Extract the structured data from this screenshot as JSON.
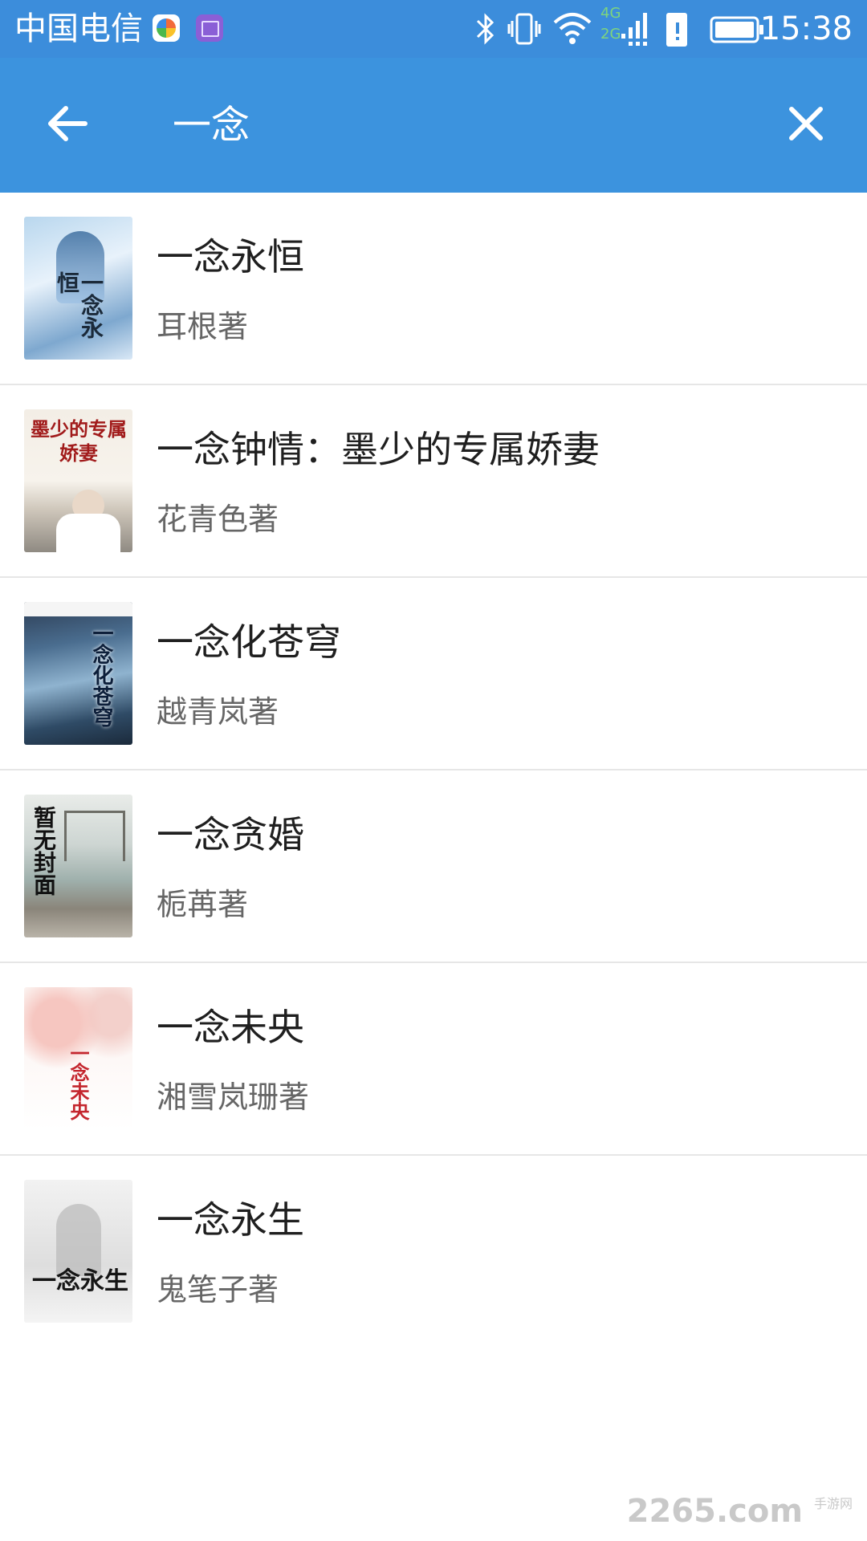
{
  "status_bar": {
    "carrier": "中国电信",
    "network_top": "4G",
    "network_bottom": "2G",
    "time": "15:38"
  },
  "search": {
    "query": "一念"
  },
  "results": [
    {
      "title": "一念永恒",
      "author": "耳根著",
      "cover_text": "一念永恒"
    },
    {
      "title": "一念钟情：墨少的专属娇妻",
      "author": "花青色著",
      "cover_text": "墨少的专属娇妻"
    },
    {
      "title": "一念化苍穹",
      "author": "越青岚著",
      "cover_text": "一念化苍穹"
    },
    {
      "title": "一念贪婚",
      "author": "栀苒著",
      "cover_text": "暂无封面"
    },
    {
      "title": "一念未央",
      "author": "湘雪岚珊著",
      "cover_text": "一念未央"
    },
    {
      "title": "一念永生",
      "author": "鬼笔子著",
      "cover_text": "一念永生"
    }
  ],
  "watermark": {
    "brand": "2265",
    "domain": ".com",
    "site": "手游网"
  },
  "colors": {
    "status_bar": "#3c8ddb",
    "app_bar": "#3c93de",
    "divider": "#e6e6e6",
    "author_text": "#666666"
  }
}
